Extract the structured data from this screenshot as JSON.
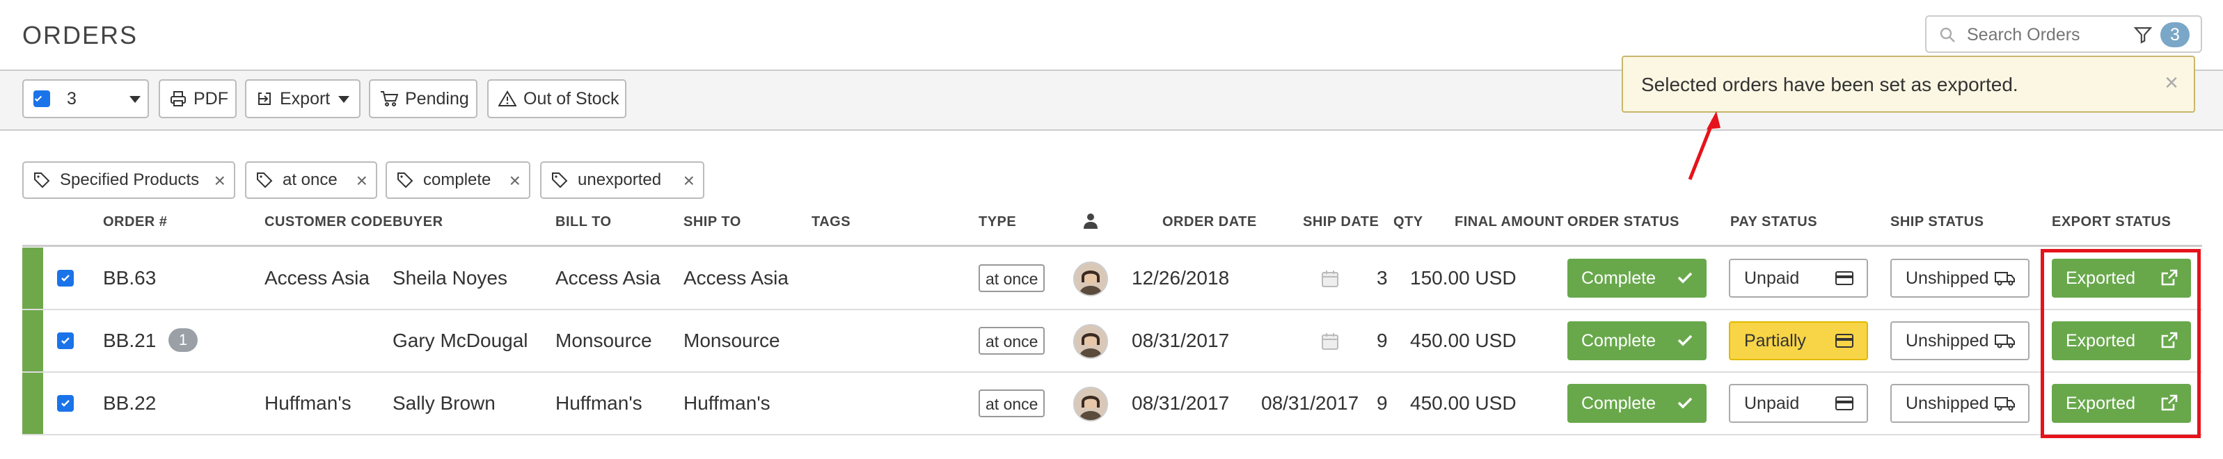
{
  "header": {
    "title": "ORDERS",
    "search_placeholder": "Search Orders",
    "filter_count": "3"
  },
  "toolbar": {
    "selected_count": "3",
    "pdf_label": "PDF",
    "export_label": "Export",
    "pending_label": "Pending",
    "out_of_stock_label": "Out of Stock"
  },
  "toast": {
    "message": "Selected orders have been set as exported.",
    "close": "×"
  },
  "chips": [
    {
      "label": "Specified Products"
    },
    {
      "label": "at once"
    },
    {
      "label": "complete"
    },
    {
      "label": "unexported"
    }
  ],
  "columns": [
    "ORDER #",
    "CUSTOMER CODE",
    "BUYER",
    "BILL TO",
    "SHIP TO",
    "TAGS",
    "TYPE",
    "ORDER DATE",
    "SHIP DATE",
    "QTY",
    "FINAL AMOUNT",
    "ORDER STATUS",
    "PAY STATUS",
    "SHIP STATUS",
    "EXPORT STATUS"
  ],
  "rows": [
    {
      "order": "BB.63",
      "badge": "",
      "customer_code": "Access Asia",
      "buyer": "Sheila Noyes",
      "bill_to": "Access Asia",
      "ship_to": "Access Asia",
      "type": "at once",
      "order_date": "12/26/2018",
      "ship_date": "",
      "qty": "3",
      "amount": "150.00 USD",
      "order_status": "Complete",
      "pay_status": "Unpaid",
      "ship_status": "Unshipped",
      "export_status": "Exported"
    },
    {
      "order": "BB.21",
      "badge": "1",
      "customer_code": "",
      "buyer": "Gary McDougal",
      "bill_to": "Monsource",
      "ship_to": "Monsource",
      "type": "at once",
      "order_date": "08/31/2017",
      "ship_date": "",
      "qty": "9",
      "amount": "450.00 USD",
      "order_status": "Complete",
      "pay_status": "Partially",
      "ship_status": "Unshipped",
      "export_status": "Exported"
    },
    {
      "order": "BB.22",
      "badge": "",
      "customer_code": "Huffman's",
      "buyer": "Sally Brown",
      "bill_to": "Huffman's",
      "ship_to": "Huffman's",
      "type": "at once",
      "order_date": "08/31/2017",
      "ship_date": "08/31/2017",
      "qty": "9",
      "amount": "450.00 USD",
      "order_status": "Complete",
      "pay_status": "Unpaid",
      "ship_status": "Unshipped",
      "export_status": "Exported"
    }
  ],
  "colors": {
    "accent_green": "#68a84b",
    "partial_yellow": "#f8d546",
    "highlight_red": "#e5131b",
    "checkbox_blue": "#1a73e8"
  }
}
